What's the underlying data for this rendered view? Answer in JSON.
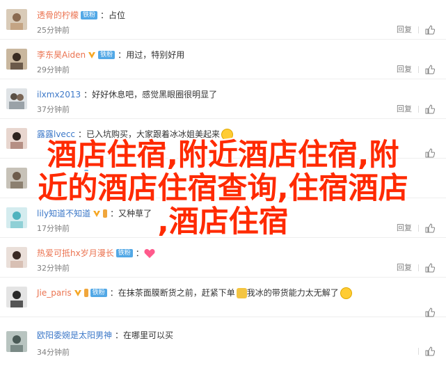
{
  "comments": [
    {
      "user": "透骨的柠檬",
      "badges": [
        "fan"
      ],
      "fan_label": "铁粉",
      "text": "占位",
      "time": "25分钟前",
      "reply": "回复",
      "likes": "",
      "emojis": []
    },
    {
      "user": "李东昊Aiden",
      "badges": [
        "v",
        "fan"
      ],
      "fan_label": "铁粉",
      "text": "用过，特别好用",
      "time": "29分钟前",
      "reply": "回复",
      "likes": "",
      "emojis": []
    },
    {
      "user": "ilxmx2013",
      "badges": [],
      "fan_label": "",
      "text": "好好休息吧，感觉黑眼圈很明显了",
      "time": "37分钟前",
      "reply": "回复",
      "likes": "",
      "emojis": []
    },
    {
      "user": "露露lvecc",
      "badges": [],
      "fan_label": "",
      "text": "已入坑购买，大家跟着冰冰姐美起来",
      "time": "",
      "reply": "",
      "likes": "",
      "emojis": [
        "grin"
      ]
    },
    {
      "user": "",
      "badges": [],
      "fan_label": "",
      "text": "",
      "time": "",
      "reply": "",
      "likes": "",
      "emojis": []
    },
    {
      "user": "lily知道不知道",
      "badges": [
        "v",
        "gold"
      ],
      "fan_label": "",
      "text": "又种草了",
      "time": "17分钟前",
      "reply": "回复",
      "likes": "",
      "emojis": []
    },
    {
      "user": "热爱可抵hx岁月漫长",
      "badges": [
        "fan"
      ],
      "fan_label": "铁粉",
      "text": "",
      "time": "32分钟前",
      "reply": "回复",
      "likes": "",
      "emojis": [
        "heart"
      ]
    },
    {
      "user": "Jie_paris",
      "badges": [
        "v",
        "gold",
        "fan"
      ],
      "fan_label": "铁粉",
      "text": "在抹茶面膜断货之前，赶紧下单",
      "text2": "我冰的带货能力太无解了",
      "time": "",
      "reply": "",
      "likes": "",
      "emojis": [
        "cat",
        "wink"
      ]
    },
    {
      "user": "欧阳委婉是太阳男神",
      "badges": [],
      "fan_label": "",
      "text": "在哪里可以买",
      "time": "34分钟前",
      "reply": "",
      "likes": "",
      "emojis": []
    }
  ],
  "overlay_text": "酒店住宿,附近酒店住宿,附\n近的酒店住宿查询,住宿酒店\n,酒店住宿",
  "overlay_color": "#ff2a00"
}
